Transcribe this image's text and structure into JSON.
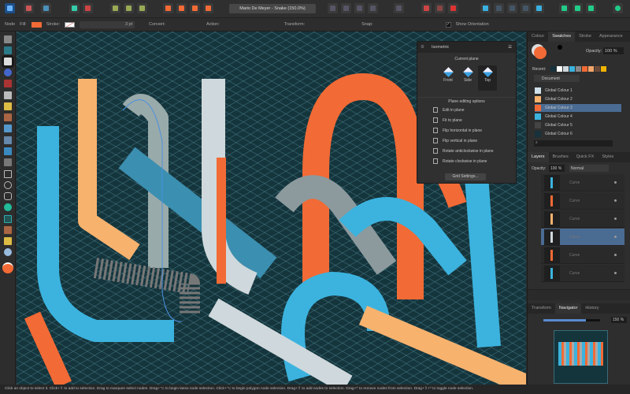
{
  "app": {
    "document_title": "Mario De Meyer - Snake (150.0%)",
    "accent": "#4a6b92",
    "fill_color": "#f26a35"
  },
  "context_toolbar": {
    "tool": "Node",
    "fill_label": "Fill:",
    "stroke_label": "Stroke:",
    "stroke_width": "3 pt",
    "convert_label": "Convert:",
    "action_label": "Action:",
    "transform_label": "Transform:",
    "snap_label": "Snap:",
    "show_orientation": "Show Orientation",
    "show_orientation_checked": true
  },
  "isometric_panel": {
    "tab": "Isometric",
    "current_plane_label": "Current plane",
    "planes": [
      "Front",
      "Side",
      "Top"
    ],
    "selected_plane": "Top",
    "editing_label": "Plane editing options",
    "options": [
      "Edit in plane",
      "Fit to plane",
      "Flip horizontal in plane",
      "Flip vertical in plane",
      "Rotate anticlockwise in plane",
      "Rotate clockwise in plane"
    ],
    "grid_settings": "Grid Settings..."
  },
  "swatches_panel": {
    "tabs": [
      "Colour",
      "Swatches",
      "Stroke",
      "Appearance"
    ],
    "active_tab": "Swatches",
    "opacity_label": "Opacity:",
    "opacity": "100 %",
    "recent_label": "Recent:",
    "recent_colors": [
      "#16323c",
      "#ffffff",
      "#cfd8dc",
      "#3bb3de",
      "#888888",
      "#f26a35",
      "#f5a66a",
      "#6b4a3a",
      "#f0b400"
    ],
    "palette": "Document",
    "swatches": [
      {
        "name": "Global Colour 1",
        "color": "#cfe0ea"
      },
      {
        "name": "Global Colour 2",
        "color": "#f7b26e"
      },
      {
        "name": "Global Colour 3",
        "color": "#f26a35"
      },
      {
        "name": "Global Colour 4",
        "color": "#3bb3de"
      },
      {
        "name": "Global Colour 5",
        "color": "#444444"
      },
      {
        "name": "Global Colour 6",
        "color": "#16323c"
      }
    ],
    "selected_swatch": "Global Colour 3",
    "search_placeholder": ""
  },
  "layers_panel": {
    "tabs": [
      "Layers",
      "Brushes",
      "Quick FX",
      "Styles"
    ],
    "active_tab": "Layers",
    "opacity_label": "Opacity:",
    "opacity": "100 %",
    "blend_mode": "Normal",
    "layers": [
      "Curve",
      "Curve",
      "Curve",
      "Curve",
      "Curve",
      "Curve"
    ],
    "selected_index": 3
  },
  "navigator_panel": {
    "tabs": [
      "Transform",
      "Navigator",
      "History"
    ],
    "active_tab": "Navigator",
    "zoom": "150 %",
    "zoom_slider_fraction": 0.75
  },
  "status_bar": {
    "text": "Click an object to select it. Click+⇧ to add to selection. Drag to marquee select nodes. Drag+⌥ to begin lasso node selection. Click+⌥ to begin polygon node selection. Drag+⇧ to add nodes to selection. Drag+^ to remove nodes from selection. Drag+⇧+^ to toggle node selection."
  }
}
